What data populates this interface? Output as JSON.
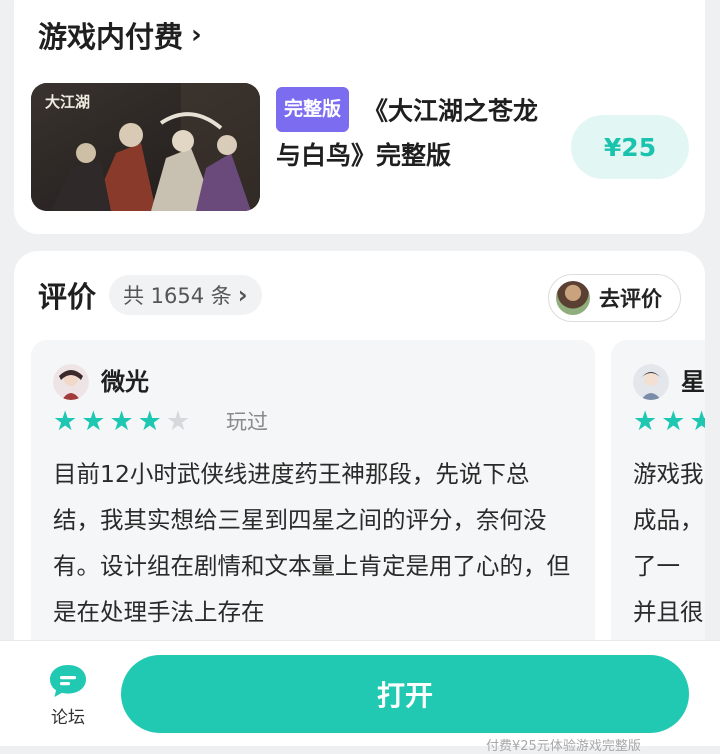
{
  "iap": {
    "title": "游戏内付费",
    "chevron": "›",
    "item": {
      "badge": "完整版",
      "name": "《大江湖之苍龙与白鸟》完整版",
      "price": "¥25",
      "thumb_text": "大江湖"
    }
  },
  "reviews": {
    "title": "评价",
    "count_label": "共 1654 条",
    "chevron": "›",
    "write_button": "去评价",
    "items": [
      {
        "user": "微光",
        "rating": 4,
        "max_rating": 5,
        "status": "玩过",
        "text": "目前12小时武侠线进度药王神那段，先说下总结，我其实想给三星到四星之间的评分，奈何没有。设计组在剧情和文本量上肯定是用了心的，但是在处理手法上存在"
      },
      {
        "user": "星",
        "rating": 3,
        "max_rating": 5,
        "lines": [
          "游戏我",
          "成品，",
          "了一",
          "并且很"
        ]
      }
    ]
  },
  "bottom_bar": {
    "forum_label": "论坛",
    "open_button": "打开",
    "fine_print": "付费¥25元体验游戏完整版"
  },
  "colors": {
    "accent": "#22c9b2",
    "star_on": "#1dc7b2",
    "star_off": "#d6d8db",
    "badge": "#7b6cf0",
    "price_bg": "#e2f7f4",
    "price_text": "#19c3ad"
  },
  "icons": {
    "forum": "chat-bubble-icon",
    "chevron": "chevron-right-icon"
  }
}
